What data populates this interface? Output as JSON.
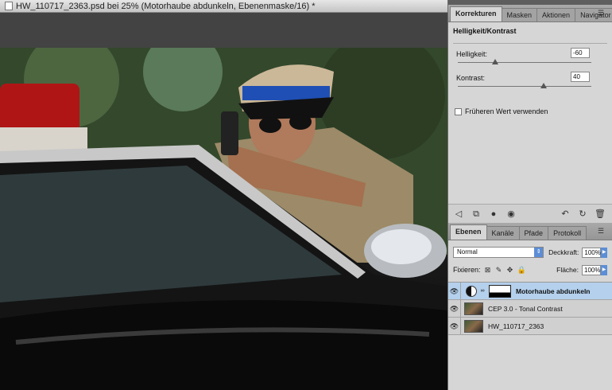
{
  "document": {
    "title": "HW_110717_2363.psd bei 25% (Motorhaube abdunkeln, Ebenenmaske/16) *"
  },
  "adjustments_panel": {
    "tabs": [
      "Korrekturen",
      "Masken",
      "Aktionen",
      "Navigator"
    ],
    "active_tab": "Korrekturen",
    "title": "Helligkeit/Kontrast",
    "brightness": {
      "label": "Helligkeit:",
      "value": "-60",
      "fraction": 0.28
    },
    "contrast": {
      "label": "Kontrast:",
      "value": "40",
      "fraction": 0.64
    },
    "legacy_checkbox_label": "Früheren Wert verwenden",
    "legacy_checked": false
  },
  "layers_panel": {
    "tabs": [
      "Ebenen",
      "Kanäle",
      "Pfade",
      "Protokoll"
    ],
    "active_tab": "Ebenen",
    "blend_mode": "Normal",
    "opacity_label": "Deckkraft:",
    "opacity_value": "100%",
    "lock_label": "Fixieren:",
    "fill_label": "Fläche:",
    "fill_value": "100%",
    "layers": [
      {
        "name": "Motorhaube abdunkeln",
        "type": "adjustment",
        "selected": true
      },
      {
        "name": "CEP 3.0 - Tonal Contrast",
        "type": "image",
        "selected": false
      },
      {
        "name": "HW_110717_2363",
        "type": "image",
        "selected": false
      }
    ]
  }
}
